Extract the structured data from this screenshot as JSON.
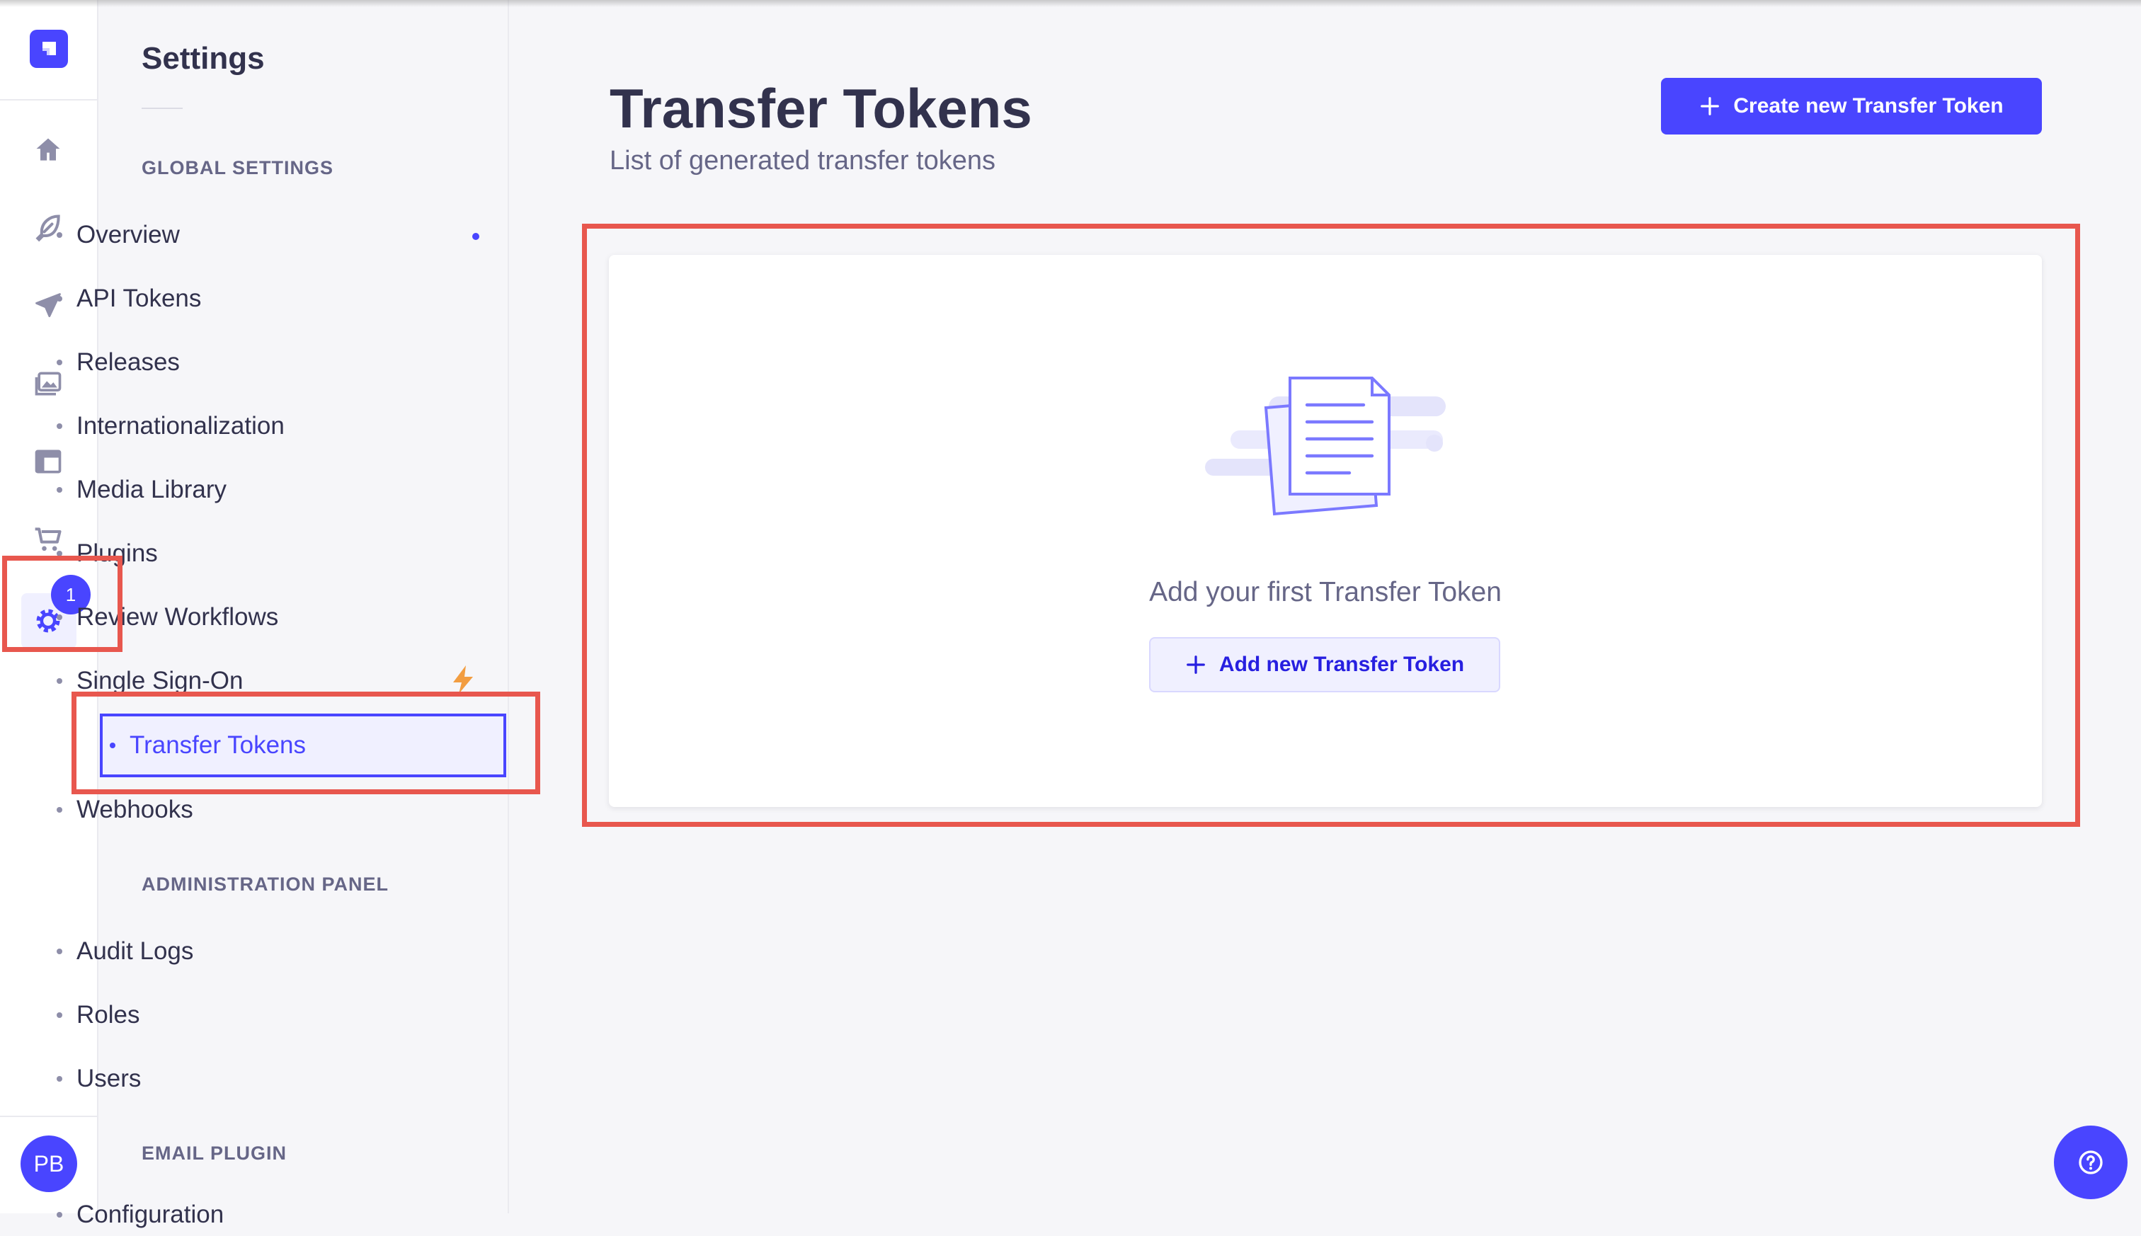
{
  "rail": {
    "icons": [
      "home-icon",
      "feather-icon",
      "paper-plane-icon",
      "images-icon",
      "layout-icon",
      "cart-icon",
      "gear-icon"
    ],
    "badge": "1",
    "avatar": "PB"
  },
  "subnav": {
    "title": "Settings",
    "sections": {
      "global": "GLOBAL SETTINGS",
      "admin": "ADMINISTRATION PANEL",
      "email": "EMAIL PLUGIN"
    },
    "global_items": [
      "Overview",
      "API Tokens",
      "Releases",
      "Internationalization",
      "Media Library",
      "Plugins",
      "Review Workflows",
      "Single Sign-On",
      "Transfer Tokens",
      "Webhooks"
    ],
    "admin_items": [
      "Audit Logs",
      "Roles",
      "Users"
    ],
    "email_items": [
      "Configuration"
    ]
  },
  "main": {
    "title": "Transfer Tokens",
    "subtitle": "List of generated transfer tokens",
    "create_button": "Create new Transfer Token",
    "empty_text": "Add your first Transfer Token",
    "add_button": "Add new Transfer Token"
  },
  "colors": {
    "primary": "#4945ff",
    "annotation": "#e8574e",
    "warning": "#f29d41"
  }
}
